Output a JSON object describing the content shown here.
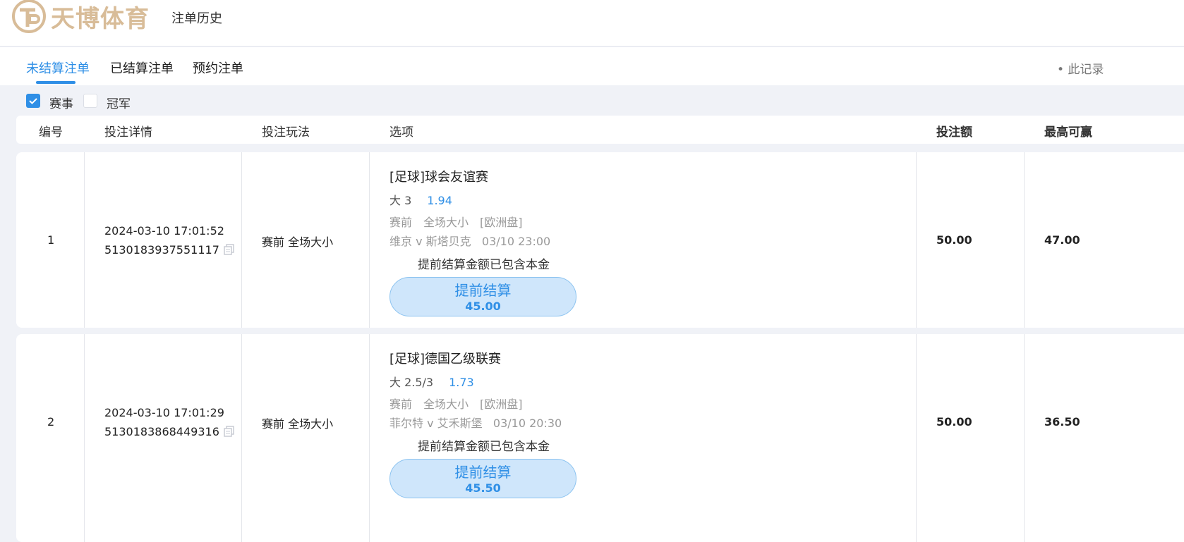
{
  "header": {
    "logo_text": "天博体育",
    "nav_title": "注单历史"
  },
  "tabs": [
    {
      "label": "未结算注单",
      "active": true
    },
    {
      "label": "已结算注单",
      "active": false
    },
    {
      "label": "预约注单",
      "active": false
    }
  ],
  "note": "• 此记录",
  "filters": [
    {
      "label": "赛事",
      "checked": true
    },
    {
      "label": "冠军",
      "checked": false
    }
  ],
  "table": {
    "headers": {
      "no": "编号",
      "detail": "投注详情",
      "play": "投注玩法",
      "option": "选项",
      "stake": "投注额",
      "maxwin": "最高可赢"
    },
    "rows": [
      {
        "no": "1",
        "time": "2024-03-10 17:01:52",
        "order_id": "5130183937551117",
        "play": "赛前 全场大小",
        "league": "[足球]球会友谊赛",
        "selection": "大 3",
        "odds": "1.94",
        "market": "赛前　全场大小　[欧洲盘]",
        "match": "维京 v 斯塔贝克",
        "match_time": "03/10 23:00",
        "cashout_note": "提前结算金额已包含本金",
        "cashout_label": "提前结算",
        "cashout_amount": "45.00",
        "stake": "50.00",
        "max_win": "47.00"
      },
      {
        "no": "2",
        "time": "2024-03-10 17:01:29",
        "order_id": "5130183868449316",
        "play": "赛前 全场大小",
        "league": "[足球]德国乙级联赛",
        "selection": "大 2.5/3",
        "odds": "1.73",
        "market": "赛前　全场大小　[欧洲盘]",
        "match": "菲尔特 v 艾禾斯堡",
        "match_time": "03/10 20:30",
        "cashout_note": "提前结算金额已包含本金",
        "cashout_label": "提前结算",
        "cashout_amount": "45.50",
        "stake": "50.00",
        "max_win": "36.50"
      }
    ]
  },
  "colors": {
    "accent": "#2f8fe6",
    "logo": "#d8bc98",
    "cashout_bg": "#cfe6fb"
  }
}
